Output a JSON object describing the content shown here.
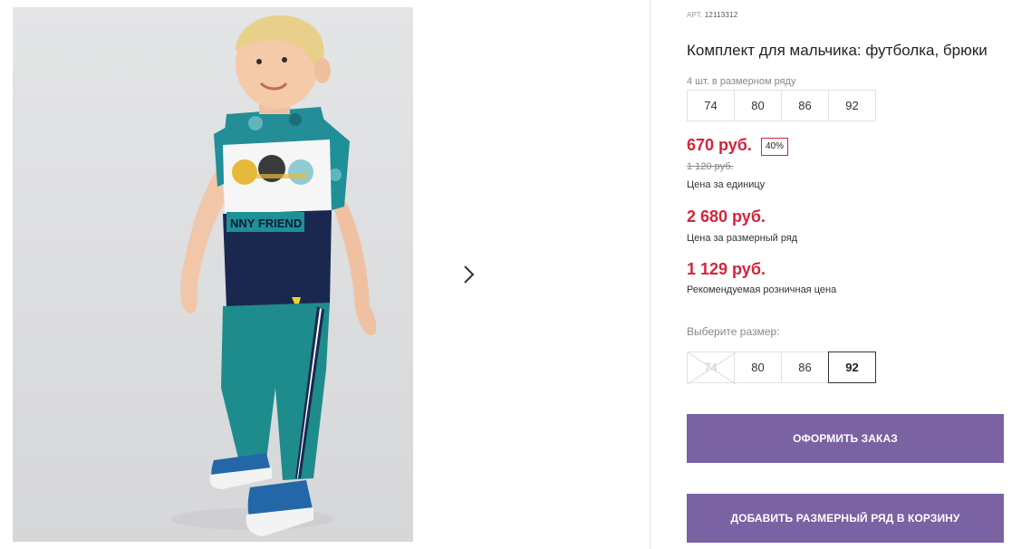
{
  "product": {
    "art_label": "АРТ.",
    "art_number": "12113312",
    "title": "Комплект для мальчика: футболка, брюки",
    "pack_note": "4 шт. в размерном ряду",
    "pack_sizes": [
      "74",
      "80",
      "86",
      "92"
    ]
  },
  "pricing": {
    "unit_price": "670 руб.",
    "discount": "40%",
    "old_price": "1 120 руб.",
    "unit_caption": "Цена за единицу",
    "pack_price": "2 680 руб.",
    "pack_caption": "Цена за размерный ряд",
    "retail_price": "1 129 руб.",
    "retail_caption": "Рекомендуемая розничная цена",
    "accent_color": "#d3253a"
  },
  "size_select": {
    "label": "Выберите размер:",
    "options": [
      {
        "label": "74",
        "state": "unavailable"
      },
      {
        "label": "80",
        "state": "available"
      },
      {
        "label": "86",
        "state": "available"
      },
      {
        "label": "92",
        "state": "selected"
      }
    ]
  },
  "actions": {
    "order_label": "ОФОРМИТЬ ЗАКАЗ",
    "add_pack_label": "ДОБАВИТЬ РАЗМЕРНЫЙ РЯД В КОРЗИНУ",
    "button_color": "#7a62a3"
  },
  "gallery": {
    "shirt_print_text": "NNY FRIEND",
    "next_icon": "chevron-right-icon"
  }
}
